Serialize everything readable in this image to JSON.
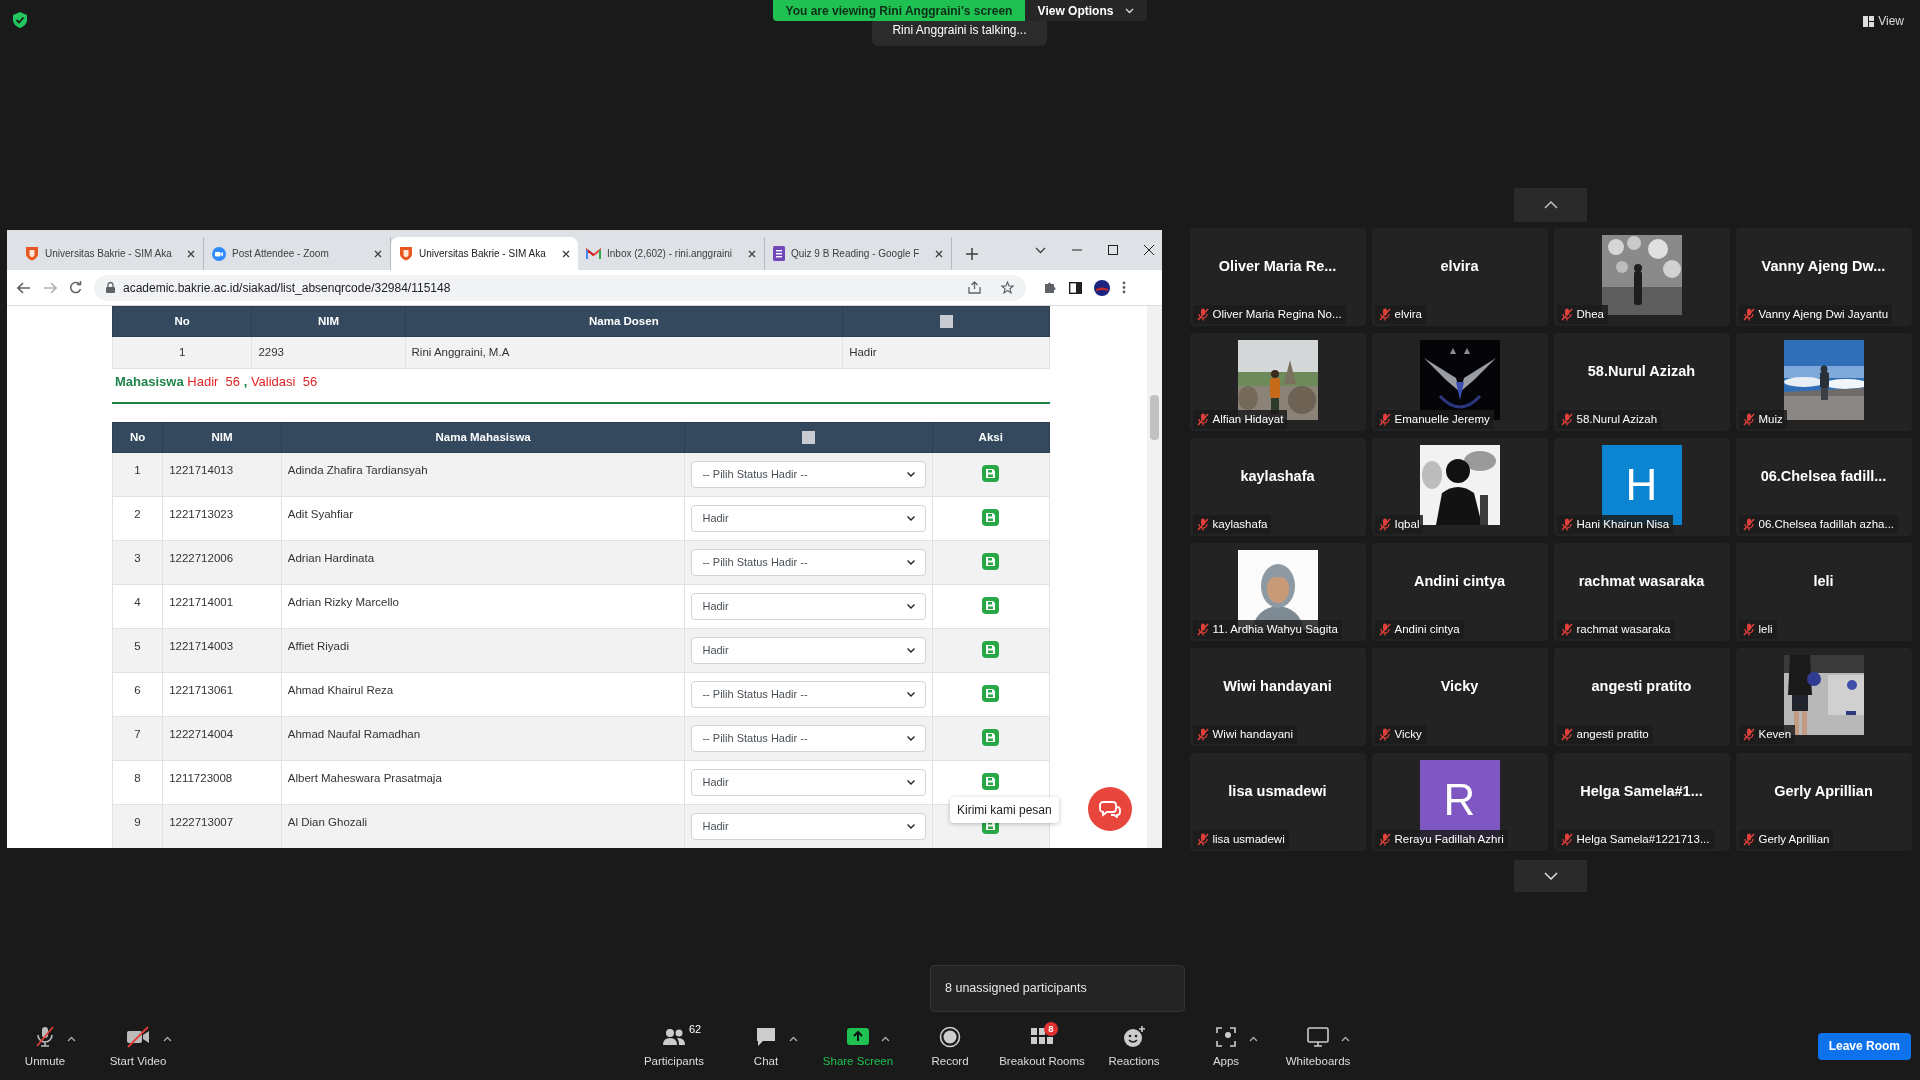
{
  "banner": {
    "text": "You are viewing Rini Anggraini's screen",
    "options": "View Options"
  },
  "talking": "Rini Anggraini is talking...",
  "view_button": "View",
  "browser": {
    "tabs": [
      {
        "title": "Universitas Bakrie - SIM Aka",
        "kind": "shield",
        "selected": false
      },
      {
        "title": "Post Attendee - Zoom",
        "kind": "zoom",
        "selected": false
      },
      {
        "title": "Universitas Bakrie - SIM Aka",
        "kind": "shield",
        "selected": true
      },
      {
        "title": "Inbox (2,602) - rini.anggraini",
        "kind": "mail",
        "selected": false
      },
      {
        "title": "Quiz 9 B Reading - Google F",
        "kind": "form",
        "selected": false
      }
    ],
    "url": "academic.bakrie.ac.id/siakad/list_absenqrcode/32984/115148"
  },
  "lecturer_table": {
    "columns": [
      "No",
      "NIM",
      "Nama Dosen"
    ],
    "select_all_checked": false,
    "rows": [
      {
        "no": "1",
        "nim": "2293",
        "name": "Rini Anggraini, M.A",
        "status": "Hadir"
      }
    ]
  },
  "summary": {
    "label": "Mahasiswa",
    "present": "Hadir  56",
    "separator": ",",
    "validated": "Validasi  56"
  },
  "student_table": {
    "columns": [
      "No",
      "NIM",
      "Nama Mahasiswa",
      "Aksi"
    ],
    "select_all_checked": false,
    "rows": [
      {
        "no": "1",
        "nim": "1221714013",
        "name": "Adinda Zhafira Tardiansyah",
        "status": "-- Pilih Status Hadir --"
      },
      {
        "no": "2",
        "nim": "1221713023",
        "name": "Adit Syahfiar",
        "status": "Hadir"
      },
      {
        "no": "3",
        "nim": "1222712006",
        "name": "Adrian Hardinata",
        "status": "-- Pilih Status Hadir --"
      },
      {
        "no": "4",
        "nim": "1221714001",
        "name": "Adrian Rizky Marcello",
        "status": "Hadir"
      },
      {
        "no": "5",
        "nim": "1221714003",
        "name": "Affiet Riyadi",
        "status": "Hadir"
      },
      {
        "no": "6",
        "nim": "1221713061",
        "name": "Ahmad Khairul Reza",
        "status": "-- Pilih Status Hadir --"
      },
      {
        "no": "7",
        "nim": "1222714004",
        "name": "Ahmad Naufal Ramadhan",
        "status": "-- Pilih Status Hadir --"
      },
      {
        "no": "8",
        "nim": "1211723008",
        "name": "Albert Maheswara Prasatmaja",
        "status": "Hadir"
      },
      {
        "no": "9",
        "nim": "1222713007",
        "name": "Al Dian Ghozali",
        "status": "Hadir"
      }
    ]
  },
  "chat_widget": {
    "tooltip": "Kirimi kami pesan"
  },
  "gallery": [
    {
      "kind": "name",
      "name": "Oliver Maria Re...",
      "label": "Oliver Maria Regina No...",
      "muted": true
    },
    {
      "kind": "name",
      "name": "elvira",
      "label": "elvira",
      "muted": true
    },
    {
      "kind": "picture",
      "label": "Dhea",
      "muted": true
    },
    {
      "kind": "name",
      "name": "Vanny Ajeng Dw...",
      "label": "Vanny Ajeng Dwi Jayantu",
      "muted": true
    },
    {
      "kind": "picture",
      "label": "Alfian Hidayat",
      "muted": true
    },
    {
      "kind": "picture",
      "label": "Emanuelle Jeremy",
      "muted": true
    },
    {
      "kind": "name",
      "name": "58.Nurul Azizah",
      "label": "58.Nurul Azizah",
      "muted": true
    },
    {
      "kind": "picture",
      "label": "Muiz",
      "muted": true
    },
    {
      "kind": "name",
      "name": "kaylashafa",
      "label": "kaylashafa",
      "muted": true
    },
    {
      "kind": "picture",
      "label": "Iqbal",
      "muted": true
    },
    {
      "kind": "letter",
      "letter": "H",
      "color": "#0b84d2",
      "label": "Hani Khairun Nisa",
      "muted": true
    },
    {
      "kind": "name",
      "name": "06.Chelsea fadill...",
      "label": "06.Chelsea fadillah azha...",
      "muted": true
    },
    {
      "kind": "picture",
      "label": "11. Ardhia Wahyu Sagita",
      "muted": true
    },
    {
      "kind": "name",
      "name": "Andini cintya",
      "label": "Andini cintya",
      "muted": true
    },
    {
      "kind": "name",
      "name": "rachmat wasaraka",
      "label": "rachmat wasaraka",
      "muted": true
    },
    {
      "kind": "name",
      "name": "leli",
      "label": "leli",
      "muted": true
    },
    {
      "kind": "name",
      "name": "Wiwi handayani",
      "label": "Wiwi handayani",
      "muted": true
    },
    {
      "kind": "name",
      "name": "Vicky",
      "label": "Vicky",
      "muted": true
    },
    {
      "kind": "name",
      "name": "angesti pratito",
      "label": "angesti pratito",
      "muted": true
    },
    {
      "kind": "picture",
      "label": "Keven",
      "muted": true
    },
    {
      "kind": "name",
      "name": "lisa usmadewi",
      "label": "lisa usmadewi",
      "muted": true
    },
    {
      "kind": "letter",
      "letter": "R",
      "color": "#7e57c2",
      "label": "Rerayu Fadillah Azhri",
      "muted": true
    },
    {
      "kind": "name",
      "name": "Helga Samela#1...",
      "label": "Helga Samela#1221713...",
      "muted": true
    },
    {
      "kind": "name",
      "name": "Gerly Aprillian",
      "label": "Gerly Aprillian",
      "muted": true
    }
  ],
  "toolbar": {
    "left": [
      {
        "label": "Unmute",
        "kind": "mic-off",
        "caret": true
      },
      {
        "label": "Start Video",
        "kind": "video-off",
        "caret": true
      }
    ],
    "center": [
      {
        "label": "Participants",
        "kind": "people",
        "count": "62",
        "caret": false
      },
      {
        "label": "Chat",
        "kind": "chat",
        "caret": true
      },
      {
        "label": "Share Screen",
        "kind": "share",
        "caret": true,
        "highlight": true
      },
      {
        "label": "Record",
        "kind": "record",
        "caret": false
      },
      {
        "label": "Breakout Rooms",
        "kind": "breakout",
        "badge": "8",
        "caret": false
      },
      {
        "label": "Reactions",
        "kind": "reactions",
        "caret": false
      },
      {
        "label": "Apps",
        "kind": "apps",
        "caret": true
      },
      {
        "label": "Whiteboards",
        "kind": "whiteboard",
        "caret": true
      }
    ],
    "leave": "Leave Room"
  },
  "tooltip": "8 unassigned participants"
}
